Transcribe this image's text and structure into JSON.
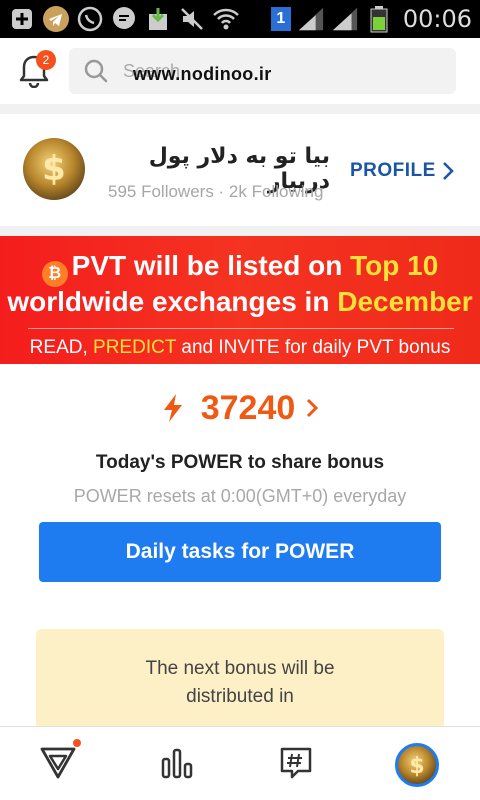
{
  "status_bar": {
    "time": "00:06",
    "sim_badge": "1"
  },
  "header": {
    "notification_count": "2",
    "search_placeholder": "Search",
    "watermark": "www.nodinoo.ir"
  },
  "profile": {
    "name": "بیا تو به دلار پول دربیار",
    "stats": "595 Followers · 2k Following",
    "profile_button": "PROFILE"
  },
  "banner": {
    "line1_prefix": "PVT will be listed on ",
    "line1_highlight": "Top 10",
    "line2_prefix": "worldwide exchanges in ",
    "line2_highlight": "December",
    "line3_a": "READ, ",
    "line3_b": "PREDICT",
    "line3_c": " and INVITE for daily PVT bonus"
  },
  "power": {
    "value": "37240",
    "title": "Today's POWER to share bonus",
    "subtitle": "POWER resets at 0:00(GMT+0) everyday",
    "button": "Daily tasks for POWER"
  },
  "bonus": {
    "line1": "The next bonus will be",
    "line2": "distributed in"
  },
  "colors": {
    "accent_blue": "#1e7bf0",
    "power_orange": "#ee5a14",
    "banner_red": "#f41d1d",
    "highlight_yellow": "#ffe13a",
    "bonus_bg": "#fdf0c7"
  }
}
